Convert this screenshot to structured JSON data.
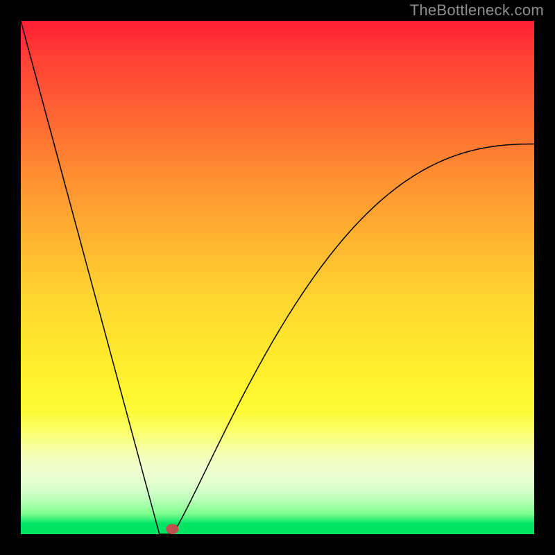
{
  "watermark": "TheBottleneck.com",
  "chart_data": {
    "type": "line",
    "title": "",
    "xlabel": "",
    "ylabel": "",
    "xlim": [
      0,
      1
    ],
    "ylim": [
      0,
      1
    ],
    "curve": {
      "x_start": 0.0,
      "y_start": 1.0,
      "x_min": 0.288,
      "flat_start_x": 0.27,
      "flat_end_x": 0.295,
      "x_end": 1.0,
      "y_end": 0.76,
      "right_shape_k": 1.15
    },
    "marker": {
      "x": 0.295,
      "y": 0.01,
      "rx": 0.012,
      "ry": 0.01,
      "color": "#c0504d"
    }
  },
  "colors": {
    "gradient_top": "#ff1e34",
    "gradient_bottom": "#00e463",
    "curve": "#000000",
    "frame": "#000000",
    "watermark": "#8f8f8f"
  }
}
